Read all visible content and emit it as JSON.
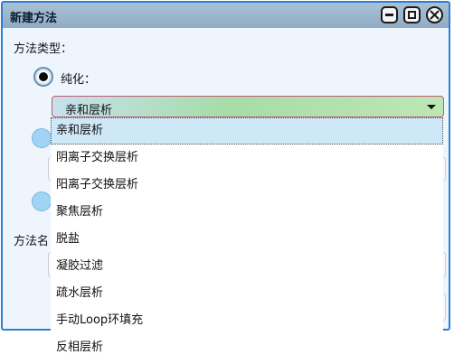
{
  "window": {
    "title": "新建方法"
  },
  "form": {
    "method_type_label": "方法类型：",
    "purification_label": "纯化：",
    "method_name_label_partial": "方法名"
  },
  "combo": {
    "selected_value": "亲和层析"
  },
  "dropdown": {
    "items": [
      "亲和层析",
      "阴离子交换层析",
      "阳离子交换层析",
      "聚焦层析",
      "脱盐",
      "凝胶过滤",
      "疏水层析",
      "手动Loop环填充",
      "反相层析"
    ],
    "selected_index": 0
  },
  "icons": {
    "minimize": "minimize-icon",
    "maximize": "maximize-icon",
    "close": "close-icon",
    "dropdown_arrow": "chevron-down-icon"
  },
  "colors": {
    "window_border": "#2d7fd0",
    "titlebar": "#9fb8ce",
    "selected_item": "#cfe8f8",
    "combo_border": "#c05a74"
  }
}
